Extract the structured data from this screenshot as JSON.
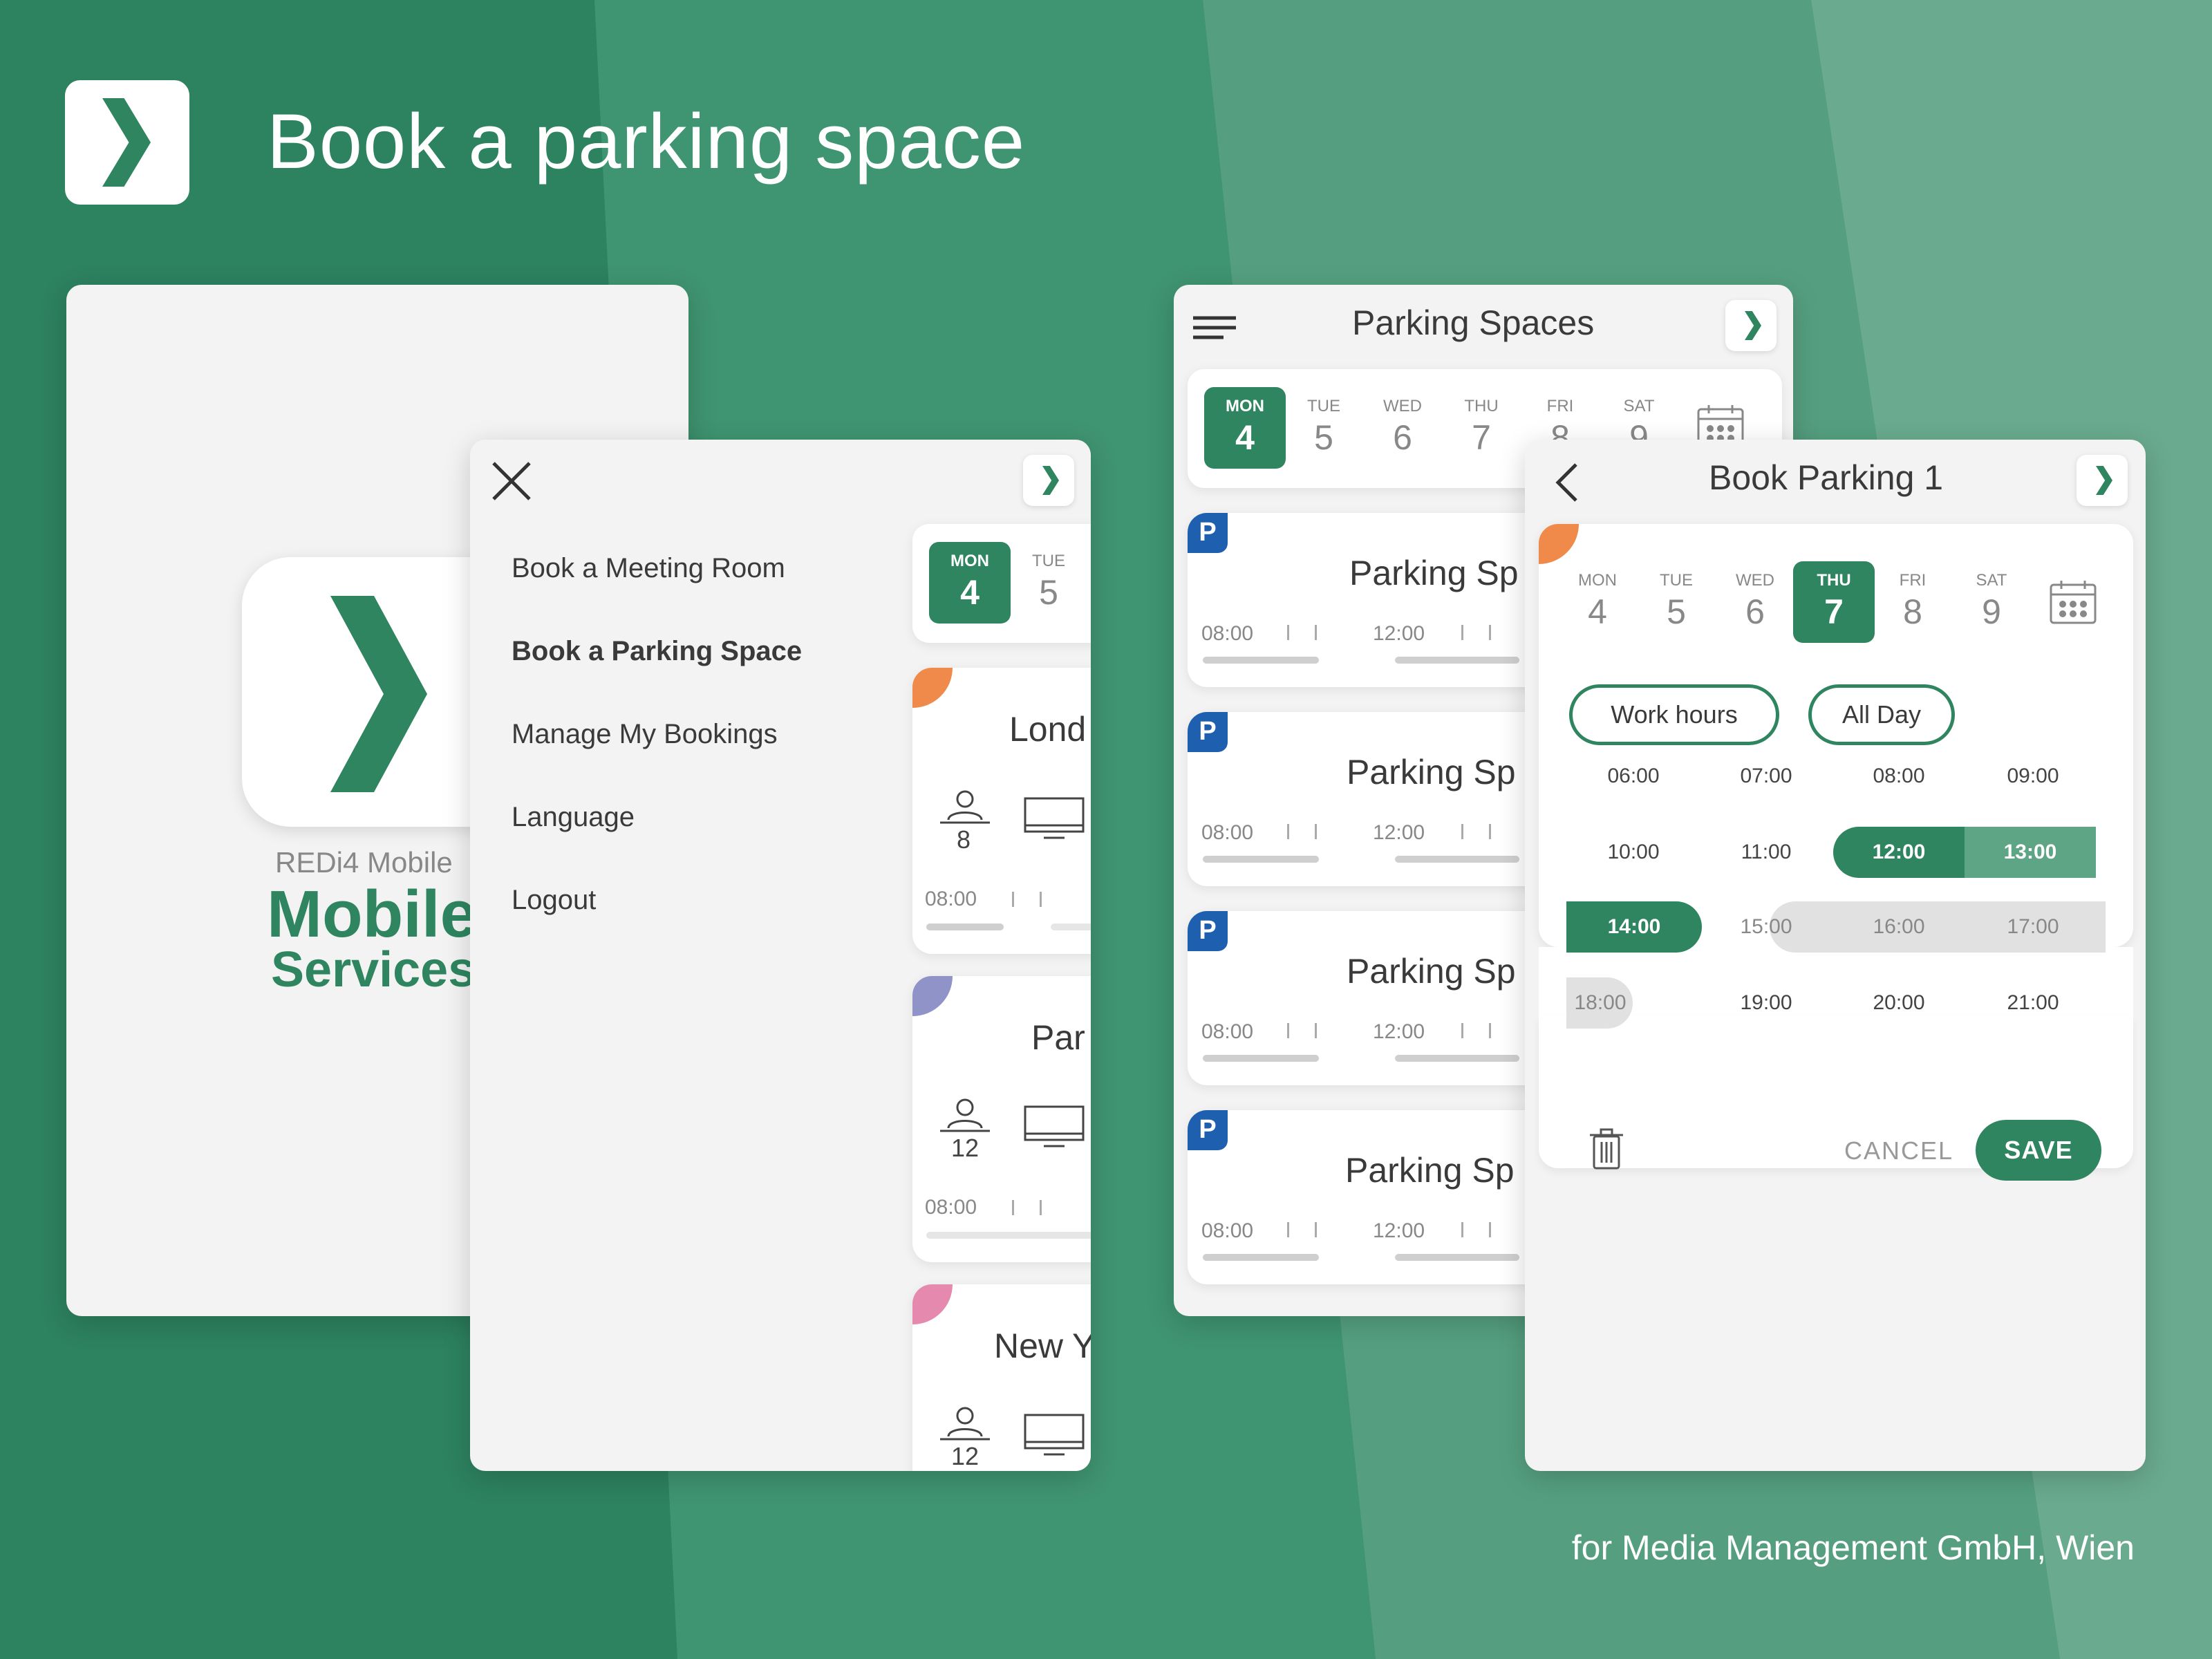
{
  "header": {
    "title": "Book a parking space"
  },
  "footer": {
    "credit": "for Media Management GmbH, Wien"
  },
  "splash": {
    "subtitle": "REDi4 Mobile",
    "title_line1": "Mobile",
    "title_line2": "Services"
  },
  "menu": {
    "items": [
      {
        "label": "Book a Meeting Room",
        "active": false
      },
      {
        "label": "Book a Parking Space",
        "active": true
      },
      {
        "label": "Manage My Bookings",
        "active": false
      },
      {
        "label": "Language",
        "active": false
      },
      {
        "label": "Logout",
        "active": false
      }
    ],
    "calendar": [
      {
        "day": "MON",
        "date": "4",
        "selected": true
      },
      {
        "day": "TUE",
        "date": "5",
        "selected": false
      }
    ],
    "rooms": [
      {
        "name": "Lond",
        "capacity": "8",
        "time": "08:00",
        "color": "#f08a4b"
      },
      {
        "name": "Par",
        "capacity": "12",
        "time": "08:00",
        "color": "#8f93c7"
      },
      {
        "name": "New Y",
        "capacity": "12",
        "color": "#e58aae"
      }
    ]
  },
  "parking_list": {
    "title": "Parking Spaces",
    "calendar": [
      {
        "day": "MON",
        "date": "4",
        "selected": true
      },
      {
        "day": "TUE",
        "date": "5",
        "selected": false
      },
      {
        "day": "WED",
        "date": "6",
        "selected": false
      },
      {
        "day": "THU",
        "date": "7",
        "selected": false
      },
      {
        "day": "FRI",
        "date": "8",
        "selected": false
      },
      {
        "day": "SAT",
        "date": "9",
        "selected": false
      }
    ],
    "badge": "P",
    "spaces": [
      {
        "name": "Parking Sp",
        "t1": "08:00",
        "t2": "12:00"
      },
      {
        "name": "Parking Sp",
        "t1": "08:00",
        "t2": "12:00"
      },
      {
        "name": "Parking Sp",
        "t1": "08:00",
        "t2": "12:00"
      },
      {
        "name": "Parking Sp",
        "t1": "08:00",
        "t2": "12:00"
      }
    ]
  },
  "booking": {
    "title": "Book Parking 1",
    "calendar": [
      {
        "day": "MON",
        "date": "4",
        "selected": false
      },
      {
        "day": "TUE",
        "date": "5",
        "selected": false
      },
      {
        "day": "WED",
        "date": "6",
        "selected": false
      },
      {
        "day": "THU",
        "date": "7",
        "selected": true
      },
      {
        "day": "FRI",
        "date": "8",
        "selected": false
      },
      {
        "day": "SAT",
        "date": "9",
        "selected": false
      }
    ],
    "work_hours_label": "Work hours",
    "all_day_label": "All Day",
    "slots": [
      [
        "06:00",
        "07:00",
        "08:00",
        "09:00"
      ],
      [
        "10:00",
        "11:00",
        "12:00",
        "13:00"
      ],
      [
        "14:00",
        "15:00",
        "16:00",
        "17:00"
      ],
      [
        "18:00",
        "19:00",
        "20:00",
        "21:00"
      ]
    ],
    "cancel_label": "CANCEL",
    "save_label": "SAVE"
  },
  "colors": {
    "brand": "#2e8560",
    "brand_light": "#5ea585",
    "parking_badge": "#1f5fb0"
  },
  "icons": [
    "logo-chevron-icon",
    "close-icon",
    "hamburger-icon",
    "back-icon",
    "calendar-icon",
    "person-icon",
    "monitor-icon",
    "trash-icon"
  ]
}
